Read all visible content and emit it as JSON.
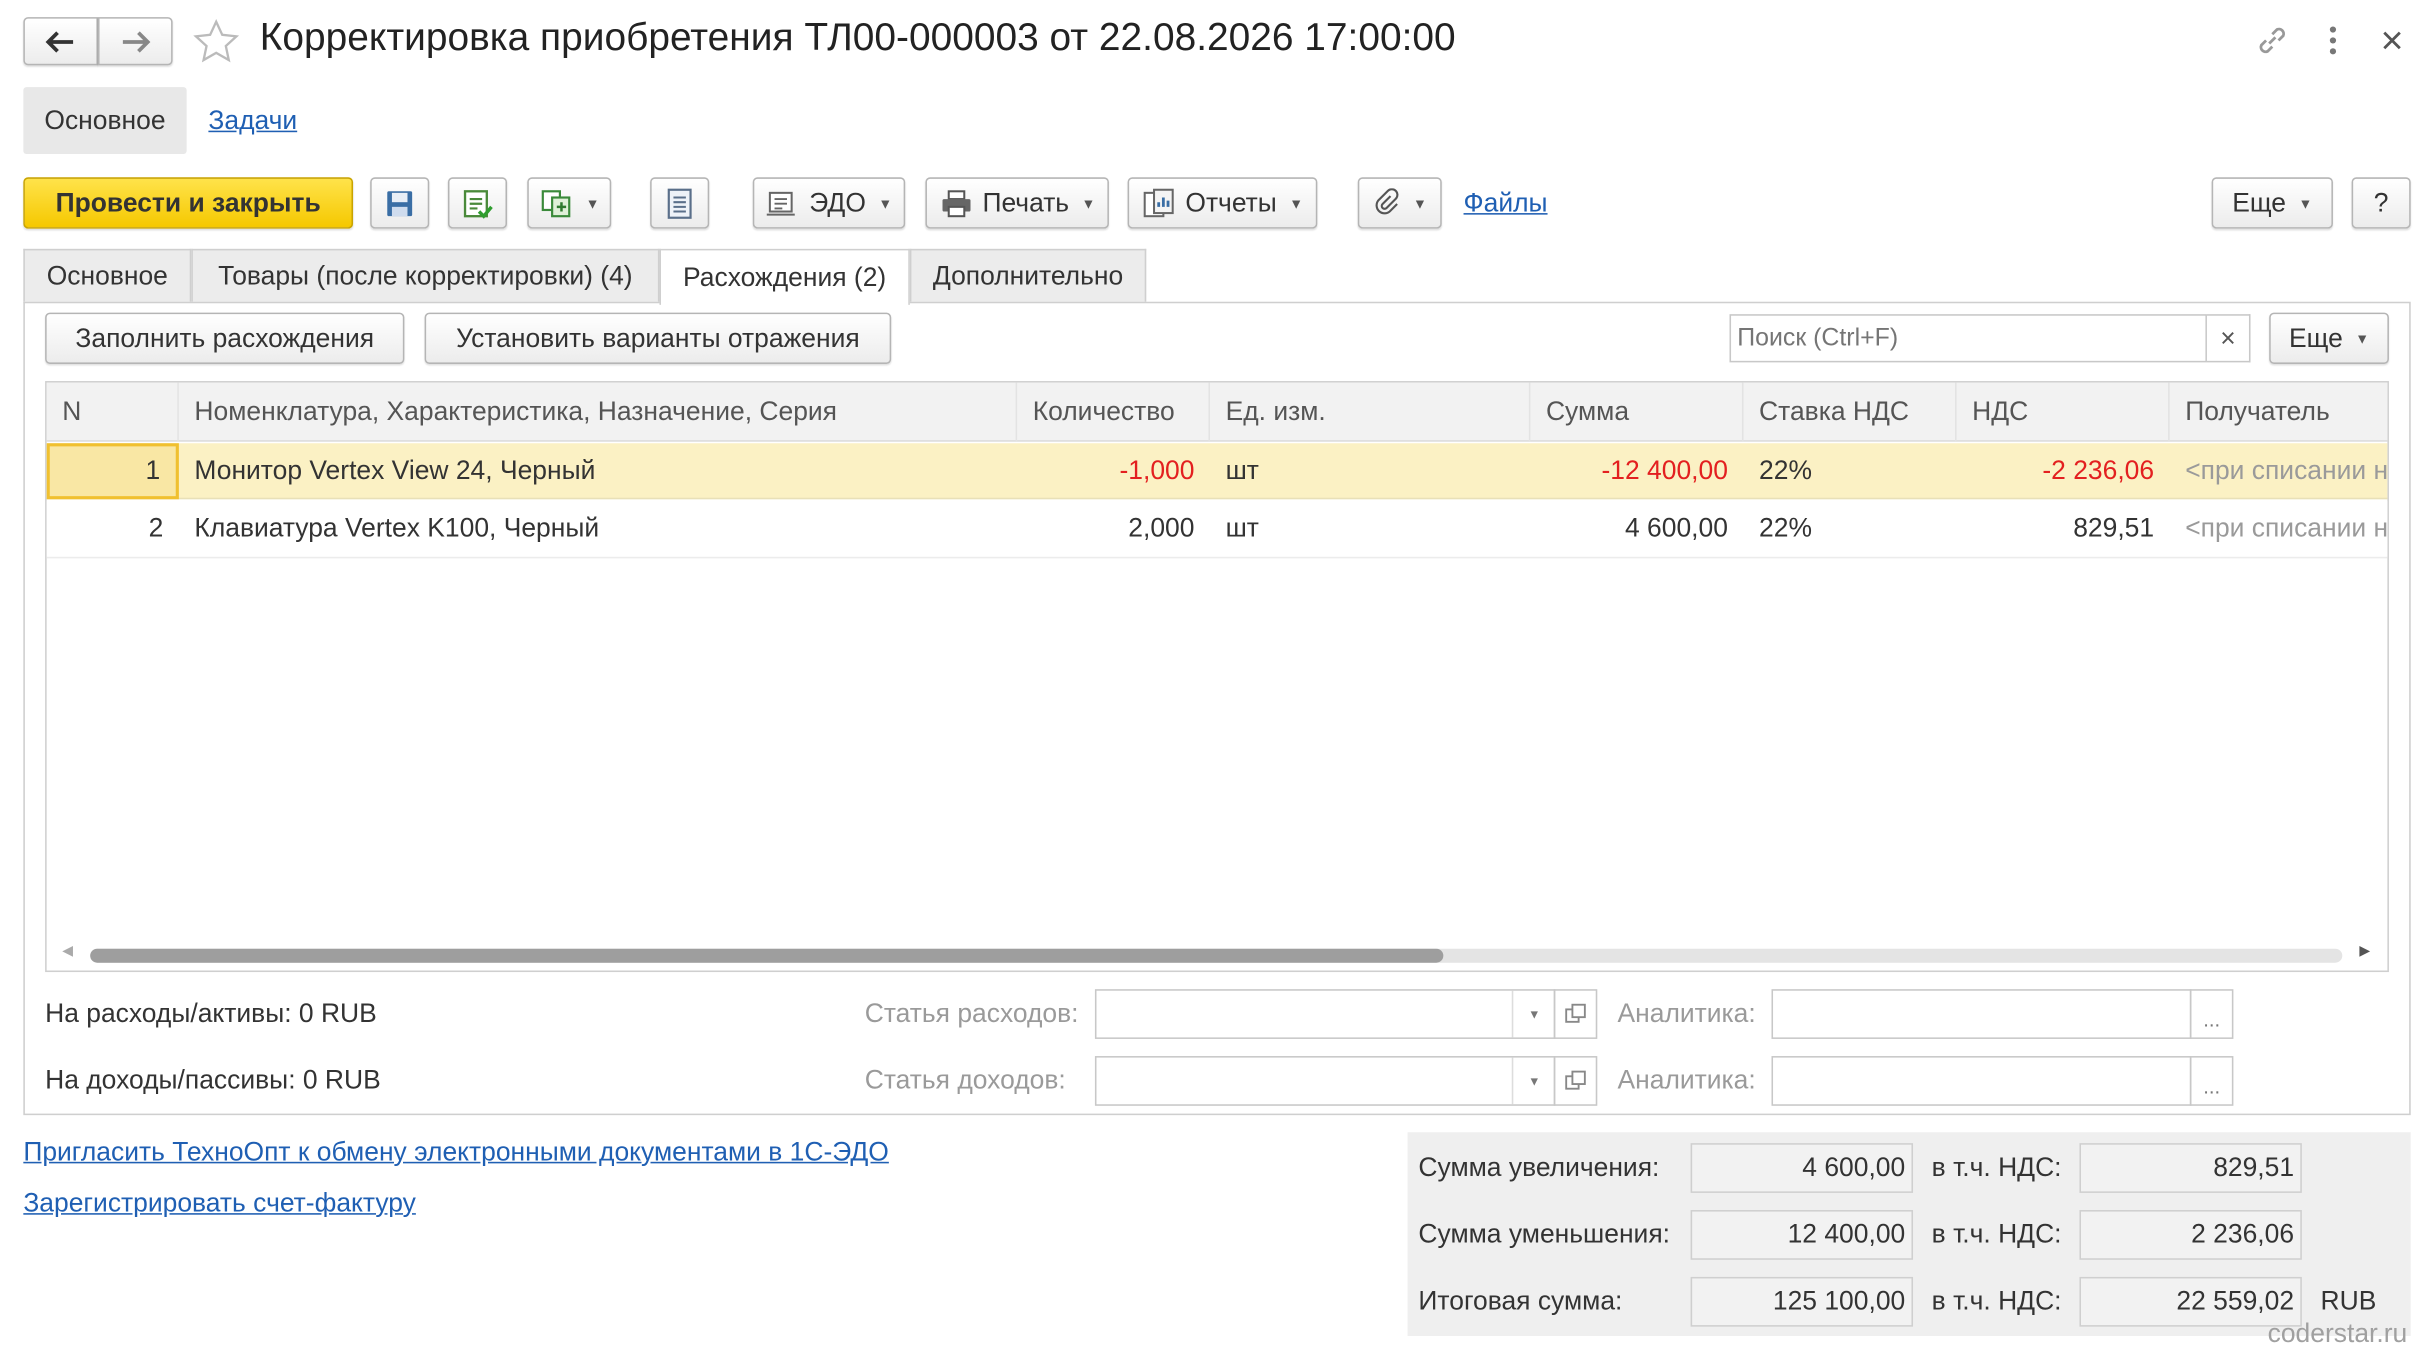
{
  "window": {
    "title": "Корректировка приобретения ТЛ00-000003 от 22.08.2026 17:00:00"
  },
  "top_tabs": {
    "main": "Основное",
    "tasks": "Задачи"
  },
  "toolbar": {
    "post_close": "Провести и закрыть",
    "edo": "ЭДО",
    "print": "Печать",
    "reports": "Отчеты",
    "files": "Файлы",
    "more": "Еще",
    "help": "?"
  },
  "tabs": [
    {
      "label": "Основное"
    },
    {
      "label": "Товары (после корректировки) (4)"
    },
    {
      "label": "Расхождения (2)"
    },
    {
      "label": "Дополнительно"
    }
  ],
  "subtoolbar": {
    "fill": "Заполнить расхождения",
    "set_variants": "Установить варианты отражения",
    "search_placeholder": "Поиск (Ctrl+F)",
    "clear": "×",
    "more": "Еще"
  },
  "table": {
    "columns": [
      "N",
      "Номенклатура, Характеристика, Назначение, Серия",
      "Количество",
      "Ед. изм.",
      "Сумма",
      "Ставка НДС",
      "НДС",
      "Получатель"
    ],
    "rows": [
      {
        "n": "1",
        "name": "Монитор Vertex View 24, Черный",
        "qty": "-1,000",
        "unit": "шт",
        "sum": "-12 400,00",
        "rate": "22%",
        "vat": "-2 236,06",
        "recipient": "<при списании на"
      },
      {
        "n": "2",
        "name": "Клавиатура Vertex K100, Черный",
        "qty": "2,000",
        "unit": "шт",
        "sum": "4 600,00",
        "rate": "22%",
        "vat": "829,51",
        "recipient": "<при списании на"
      }
    ]
  },
  "bottom": {
    "expenses_label": "На расходы/активы: 0 RUB",
    "income_label": "На доходы/пассивы: 0 RUB",
    "expense_item": "Статья расходов:",
    "income_item": "Статья доходов:",
    "analytics": "Аналитика:",
    "dots": "..."
  },
  "links": {
    "invite": "Пригласить ТехноОпт к обмену электронными документами в 1С-ЭДО",
    "register": "Зарегистрировать счет-фактуру"
  },
  "totals": {
    "increase_label": "Сумма увеличения:",
    "increase_value": "4 600,00",
    "increase_vat": "829,51",
    "decrease_label": "Сумма уменьшения:",
    "decrease_value": "12 400,00",
    "decrease_vat": "2 236,06",
    "total_label": "Итоговая сумма:",
    "total_value": "125 100,00",
    "total_vat": "22 559,02",
    "vat_label": "в т.ч. НДС:",
    "currency": "RUB"
  },
  "watermark": "coderstar.ru"
}
